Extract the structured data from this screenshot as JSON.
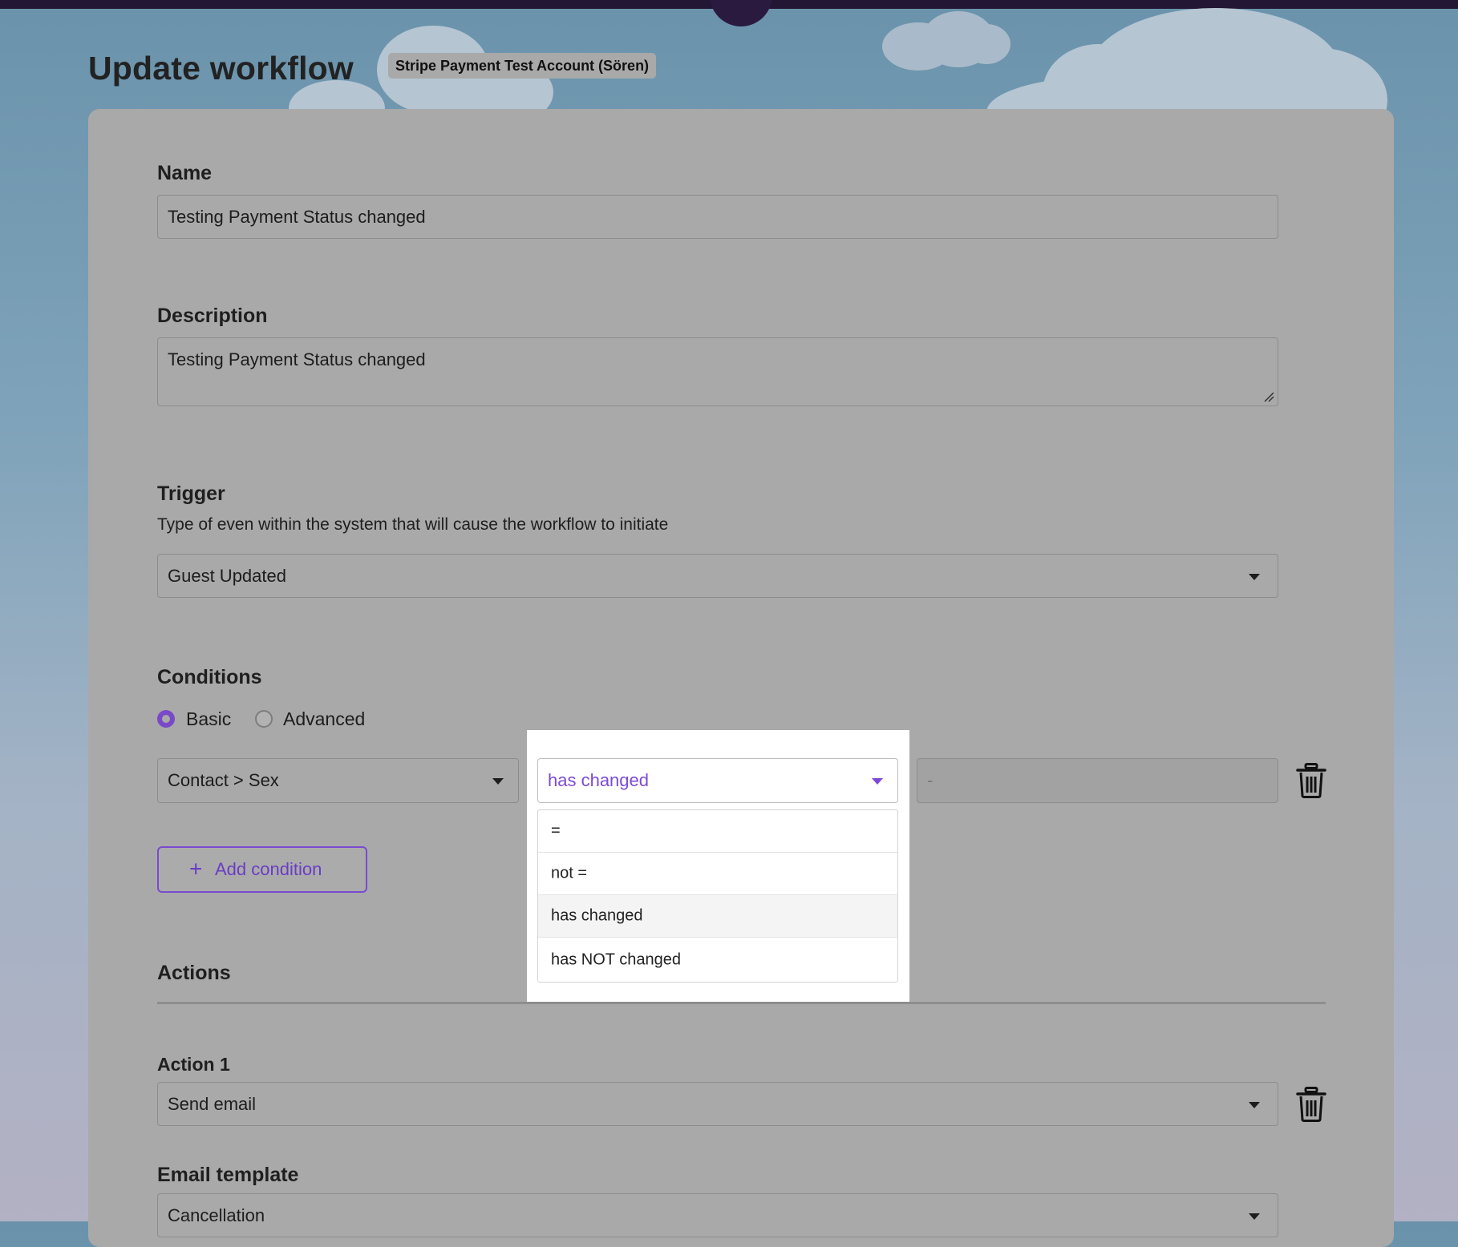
{
  "header": {
    "title": "Update workflow",
    "account_badge": "Stripe Payment Test Account (Sören)"
  },
  "form": {
    "name": {
      "label": "Name",
      "value": "Testing Payment Status changed"
    },
    "description": {
      "label": "Description",
      "value": "Testing Payment Status changed"
    },
    "trigger": {
      "label": "Trigger",
      "help": "Type of even within the system that will cause the workflow to initiate",
      "value": "Guest Updated"
    },
    "conditions": {
      "label": "Conditions",
      "mode_basic": "Basic",
      "mode_advanced": "Advanced",
      "selected_mode": "Basic",
      "field_value": "Contact > Sex",
      "operator_value": "has changed",
      "operator_options": [
        "=",
        "not =",
        "has changed",
        "has NOT changed"
      ],
      "value_placeholder": "-",
      "add_label": "Add condition",
      "add_icon": "+"
    },
    "actions": {
      "label": "Actions",
      "action1_label": "Action 1",
      "action1_value": "Send email",
      "email_template_label": "Email template",
      "email_template_value": "Cancellation"
    }
  },
  "colors": {
    "accent": "#7a4ad0",
    "topbar": "#221634",
    "card": "#a9a9a9",
    "dropdown_bg": "#ffffff"
  },
  "icons": {
    "trash": "trash-icon",
    "caret": "caret-down-icon",
    "plus": "plus-icon"
  }
}
